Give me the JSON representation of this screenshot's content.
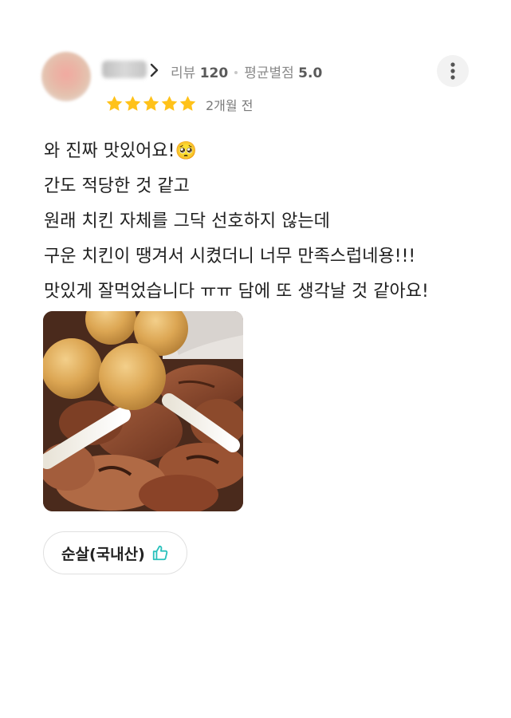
{
  "review": {
    "reviewer": {
      "name": "별이",
      "avatar_icon": "blurred-avatar"
    },
    "stats": {
      "review_label": "리뷰",
      "review_count": "120",
      "rating_label": "평균별점",
      "rating_value": "5.0"
    },
    "rating": 5,
    "date": "2개월 전",
    "text_lines": [
      "와 진짜 맛있어요!🥺",
      "간도 적당한 것 같고",
      "원래 치킨 자체를 그닥 선호하지 않는데",
      "구운 치킨이 땡겨서 시켰더니 너무 만족스럽네용!!!",
      "맛있게 잘먹었습니다 ㅠㅠ 담에 또 생각날 것 같아요!"
    ],
    "menu_tag": {
      "label": "순살(국내산)",
      "icon": "thumbs-up-icon"
    }
  },
  "colors": {
    "star": "#FFC21A",
    "thumb_icon": "#2AC1BC",
    "meta_text": "#8A8A8A"
  }
}
